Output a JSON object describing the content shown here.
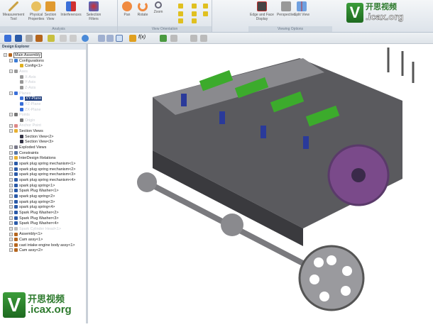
{
  "ribbon": {
    "groups": [
      {
        "label": "Analysis"
      },
      {
        "label": "View Orientation"
      },
      {
        "label": "Viewing Options"
      }
    ],
    "analysis_buttons": [
      "Measurement Tool",
      "Physical Properties",
      "Section View",
      "Interferences",
      "Selection Filters"
    ],
    "orientation_buttons": [
      "Pan",
      "Rotate",
      "Zoom"
    ],
    "viewing_buttons": [
      "Edge and Face Display",
      "Perspective",
      "Split View"
    ]
  },
  "explorer": {
    "title": "Design Explorer",
    "items": [
      {
        "label": "Main Assembly",
        "level": 0,
        "state": "boxed",
        "icon": "#b5651d"
      },
      {
        "label": "Configurations",
        "level": 1,
        "icon": "#3a7bd5"
      },
      {
        "label": "Config<1>",
        "level": 2,
        "icon": "#e0b020"
      },
      {
        "label": "Axes",
        "level": 1,
        "state": "dim",
        "icon": "#999"
      },
      {
        "label": "X-Axis",
        "level": 2,
        "state": "dim",
        "icon": "#999"
      },
      {
        "label": "Y-Axis",
        "level": 2,
        "state": "dim",
        "icon": "#999"
      },
      {
        "label": "Z-Axis",
        "level": 2,
        "state": "dim",
        "icon": "#999"
      },
      {
        "label": "Planes",
        "level": 1,
        "state": "dim",
        "icon": "#3a6fd8"
      },
      {
        "label": "XY-Plane",
        "level": 2,
        "state": "sel",
        "icon": "#3a6fd8"
      },
      {
        "label": "YZ-Plane",
        "level": 2,
        "state": "dim",
        "icon": "#3a6fd8"
      },
      {
        "label": "ZX-Plane",
        "level": 2,
        "state": "dim",
        "icon": "#3a6fd8"
      },
      {
        "label": "Points",
        "level": 1,
        "state": "dim",
        "icon": "#777"
      },
      {
        "label": "Origin",
        "level": 2,
        "state": "dim",
        "icon": "#777"
      },
      {
        "label": "Anchor Point",
        "level": 1,
        "state": "dim",
        "icon": "#d88"
      },
      {
        "label": "Section Views",
        "level": 1,
        "icon": "#e8b030"
      },
      {
        "label": "Section View<2>",
        "level": 2,
        "icon": "#334"
      },
      {
        "label": "Section View<3>",
        "level": 2,
        "icon": "#334"
      },
      {
        "label": "Exploded Views",
        "level": 1,
        "icon": "#778"
      },
      {
        "label": "Constraints",
        "level": 1,
        "icon": "#5577aa"
      },
      {
        "label": "InterDesign Relations",
        "level": 1,
        "icon": "#e8b030"
      },
      {
        "label": "spark plug spring mechanism<1>",
        "level": 1,
        "icon": "#2a5aa8"
      },
      {
        "label": "spark plug spring mechanism<2>",
        "level": 1,
        "icon": "#2a5aa8"
      },
      {
        "label": "spark plug spring mechanism<3>",
        "level": 1,
        "icon": "#2a5aa8"
      },
      {
        "label": "spark plug spring mechanism<4>",
        "level": 1,
        "icon": "#2a5aa8"
      },
      {
        "label": "spark plug spring<1>",
        "level": 1,
        "icon": "#2a5aa8"
      },
      {
        "label": "Spark Plug Washer<1>",
        "level": 1,
        "icon": "#2a5aa8"
      },
      {
        "label": "spark plug spring<2>",
        "level": 1,
        "icon": "#2a5aa8"
      },
      {
        "label": "spark plug spring<3>",
        "level": 1,
        "icon": "#2a5aa8"
      },
      {
        "label": "spark plug spring<4>",
        "level": 1,
        "icon": "#2a5aa8"
      },
      {
        "label": "Spark Plug Washer<2>",
        "level": 1,
        "icon": "#2a5aa8"
      },
      {
        "label": "Spark Plug Washer<3>",
        "level": 1,
        "icon": "#2a5aa8"
      },
      {
        "label": "Spark Plug Washer<4>",
        "level": 1,
        "icon": "#2a5aa8"
      },
      {
        "label": "Spark Cylinder Head<1>",
        "level": 1,
        "state": "dim",
        "icon": "#bbb"
      },
      {
        "label": "Assembly<1>",
        "level": 1,
        "icon": "#b5651d"
      },
      {
        "label": "Cam assy<1>",
        "level": 1,
        "icon": "#b5651d"
      },
      {
        "label": "cast intake engine body assy<1>",
        "level": 1,
        "icon": "#b5651d"
      },
      {
        "label": "Cam assy<2>",
        "level": 1,
        "icon": "#b5651d"
      }
    ]
  },
  "watermark": {
    "cn": "开思视频",
    "site": ".icax.org",
    "letter": "V"
  }
}
